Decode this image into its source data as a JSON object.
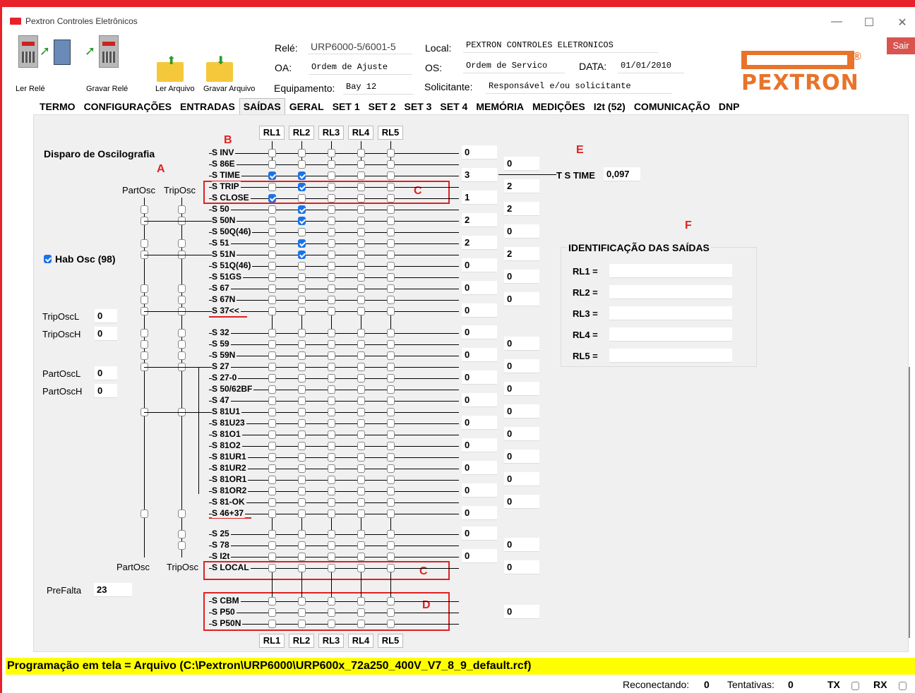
{
  "window": {
    "title": "Pextron Controles Eletrônicos",
    "min": "—",
    "max": "☐",
    "close": "✕"
  },
  "toolbar": {
    "ler_rele": "Ler Relé",
    "gravar_rele": "Gravar Relé",
    "ler_arquivo": "Ler Arquivo",
    "gravar_arquivo": "Gravar Arquivo"
  },
  "header": {
    "rele_label": "Relé:",
    "rele_value": "URP6000-5/6001-5",
    "oa_label": "OA:",
    "oa_value": "Ordem de Ajuste",
    "equip_label": "Equipamento:",
    "equip_value": "Bay 12",
    "local_label": "Local:",
    "local_value": "PEXTRON CONTROLES ELETRONICOS",
    "os_label": "OS:",
    "os_value": "Ordem de Servico",
    "data_label": "DATA:",
    "data_value": "01/01/2010",
    "solic_label": "Solicitante:",
    "solic_value": "Responsável e/ou solicitante",
    "sair": "Sair",
    "logo": "PEXTRON",
    "logo_reg": "®"
  },
  "tabs": [
    "TERMO",
    "CONFIGURAÇÕES",
    "ENTRADAS",
    "SAÍDAS",
    "GERAL",
    "SET 1",
    "SET 2",
    "SET 3",
    "SET 4",
    "MEMÓRIA",
    "MEDIÇÕES",
    "I2t (52)",
    "COMUNICAÇÃO",
    "DNP"
  ],
  "active_tab": "SAÍDAS",
  "left": {
    "title": "Disparo de Oscilografia",
    "partosc": "PartOsc",
    "triposc": "TripOsc",
    "hab_osc": "Hab Osc (98)",
    "triposcl_label": "TripOscL",
    "triposcl_value": "0",
    "triposch_label": "TripOscH",
    "triposch_value": "0",
    "partoscl_label": "PartOscL",
    "partoscl_value": "0",
    "partosch_label": "PartOscH",
    "partosch_value": "0",
    "prefalta_label": "PreFalta",
    "prefalta_value": "23"
  },
  "relays": [
    "RL1",
    "RL2",
    "RL3",
    "RL4",
    "RL5"
  ],
  "signals": [
    "S INV",
    "S 86E",
    "S TIME",
    "S TRIP",
    "S CLOSE",
    "S 50",
    "S 50N",
    "S 50Q(46)",
    "S 51",
    "S 51N",
    "S 51Q(46)",
    "S 51GS",
    "S 67",
    "S 67N",
    "S 37<<",
    "S 32",
    "S 59",
    "S 59N",
    "S 27",
    "S 27-0",
    "S 50/62BF",
    "S 47",
    "S 81U1",
    "S 81U23",
    "S 81O1",
    "S 81O2",
    "S 81UR1",
    "S 81UR2",
    "S 81OR1",
    "S 81OR2",
    "S 81-OK",
    "S 46+37",
    "S 25",
    "S 78",
    "S I2t",
    "S LOCAL",
    "S CBM",
    "S P50",
    "S P50N"
  ],
  "col1_values": [
    "0",
    "3",
    "1",
    "2",
    "2",
    "0",
    "0",
    "0",
    "0",
    "0",
    "0",
    "0",
    "0",
    "0",
    "0",
    "0",
    "0",
    "0",
    "0"
  ],
  "col2_values": [
    "0",
    "2",
    "2",
    "0",
    "2",
    "0",
    "0",
    "0",
    "0",
    "0",
    "0",
    "0",
    "0",
    "0",
    "0",
    "0",
    "0",
    "0"
  ],
  "ts_time_label": "T S TIME",
  "ts_time_value": "0,097",
  "ident": {
    "title": "IDENTIFICAÇÃO DAS SAÍDAS",
    "labels": [
      "RL1 =",
      "RL2 =",
      "RL3 =",
      "RL4 =",
      "RL5 ="
    ]
  },
  "annotations": {
    "A": "A",
    "B": "B",
    "C": "C",
    "D": "D",
    "E": "E",
    "F": "F"
  },
  "status_bar": "Programação em tela = Arquivo (C:\\Pextron\\URP6000\\URP600x_72a250_400V_V7_8_9_default.rcf)",
  "footer": {
    "reconect_label": "Reconectando:",
    "reconect_value": "0",
    "tent_label": "Tentativas:",
    "tent_value": "0",
    "tx": "TX",
    "rx": "RX"
  },
  "colors": {
    "accent": "#e8222a",
    "logo": "#e8732a",
    "check": "#1a73e8",
    "status_bg": "#ffff00",
    "annotation": "#e02020"
  }
}
